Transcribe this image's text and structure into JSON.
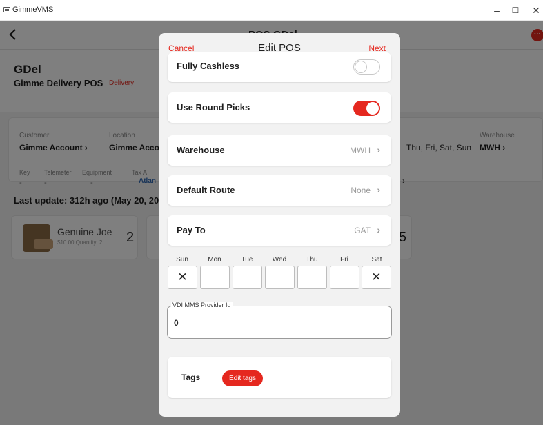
{
  "window": {
    "app_title": "GimmeVMS",
    "minimize": "–",
    "maximize": "☐",
    "close": "✕"
  },
  "app": {
    "nav_title": "POS GDel",
    "more_icon": "···",
    "pos_name": "GDel",
    "pos_subtitle": "Gimme Delivery POS",
    "pos_badge": "Delivery",
    "info": {
      "customer_label": "Customer",
      "customer_value": "Gimme Account  ›",
      "location_label": "Location",
      "location_value": "Gimme Accou",
      "days_value": "Thu, Fri, Sat, Sun",
      "warehouse_label": "Warehouse",
      "warehouse_value": "MWH  ›",
      "key_label": "Key",
      "key_value": "-",
      "telemeter_label": "Telemeter",
      "telemeter_value": "-",
      "equipment_label": "Equipment",
      "equipment_value": "-",
      "tax_label": "Tax A",
      "tax_value": "Atlan",
      "arrow": "›"
    },
    "last_update": "Last update: 312h ago (May 20, 20",
    "products": [
      {
        "name": "Genuine Joe",
        "meta": "$10.00  Quantity: 2",
        "count": "2"
      },
      {
        "count": "5"
      }
    ]
  },
  "modal": {
    "cancel_label": "Cancel",
    "title": "Edit POS",
    "next_label": "Next",
    "rows": {
      "fully_cashless": {
        "label": "Fully Cashless",
        "on": false
      },
      "use_round_picks": {
        "label": "Use Round Picks",
        "on": true
      },
      "warehouse": {
        "label": "Warehouse",
        "value": "MWH"
      },
      "default_route": {
        "label": "Default Route",
        "value": "None"
      },
      "pay_to": {
        "label": "Pay To",
        "value": "GAT"
      }
    },
    "chevron": "›",
    "days": [
      {
        "label": "Sun",
        "mark": "✕"
      },
      {
        "label": "Mon",
        "mark": ""
      },
      {
        "label": "Tue",
        "mark": ""
      },
      {
        "label": "Wed",
        "mark": ""
      },
      {
        "label": "Thu",
        "mark": ""
      },
      {
        "label": "Fri",
        "mark": ""
      },
      {
        "label": "Sat",
        "mark": "✕"
      }
    ],
    "vdi": {
      "label": "VDI MMS Provider Id",
      "value": "0"
    },
    "tags": {
      "label": "Tags",
      "button": "Edit tags"
    }
  },
  "colors": {
    "accent": "#e5281f",
    "link": "#2f67b0"
  }
}
